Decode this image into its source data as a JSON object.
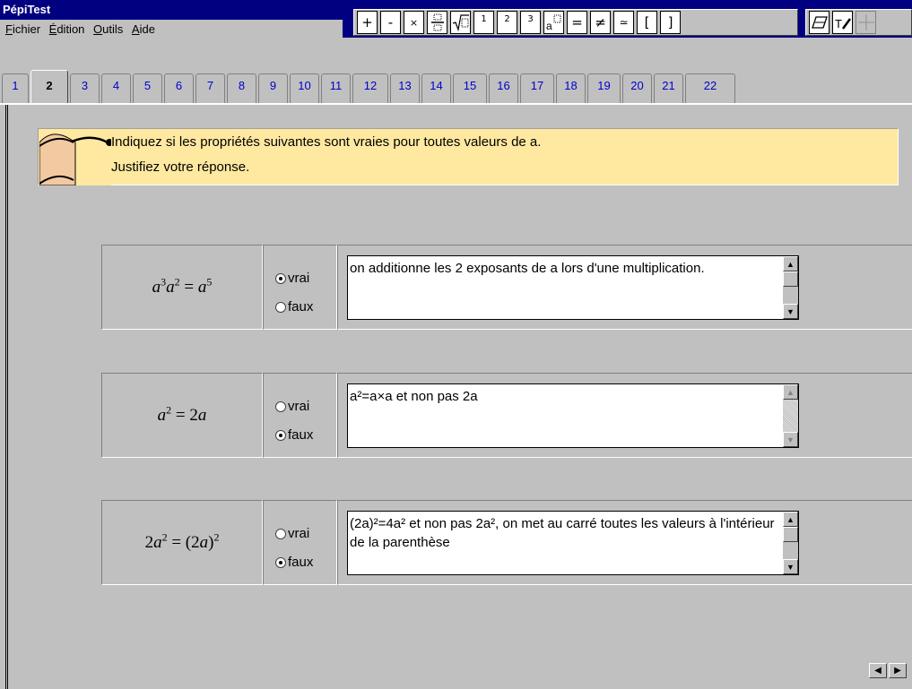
{
  "window": {
    "title": "PépiTest"
  },
  "menu": [
    "Fichier",
    "Édition",
    "Outils",
    "Aide"
  ],
  "toolbar": {
    "operators": [
      "+",
      "-",
      "×"
    ],
    "superscripts": [
      "1",
      "2",
      "3"
    ],
    "relations": [
      "=",
      "≠",
      "≃",
      "[",
      "]"
    ]
  },
  "tabs": [
    "1",
    "2",
    "3",
    "4",
    "5",
    "6",
    "7",
    "8",
    "9",
    "10",
    "11",
    "12",
    "13",
    "14",
    "15",
    "16",
    "17",
    "18",
    "19",
    "20",
    "21",
    "22"
  ],
  "active_tab": "2",
  "instruction": {
    "line1": "Indiquez si les propriétés suivantes sont vraies pour toutes valeurs de a.",
    "line2": "Justifiez votre réponse."
  },
  "radio_labels": {
    "true": "vrai",
    "false": "faux"
  },
  "questions": [
    {
      "selected": "vrai",
      "answer": "on additionne les 2 exposants de a lors d'une multiplication."
    },
    {
      "selected": "faux",
      "answer": "a²=a×a et non pas 2a"
    },
    {
      "selected": "faux",
      "answer": "(2a)²=4a² et non pas 2a², on met au carré toutes les valeurs à l'intérieur de la parenthèse"
    }
  ]
}
